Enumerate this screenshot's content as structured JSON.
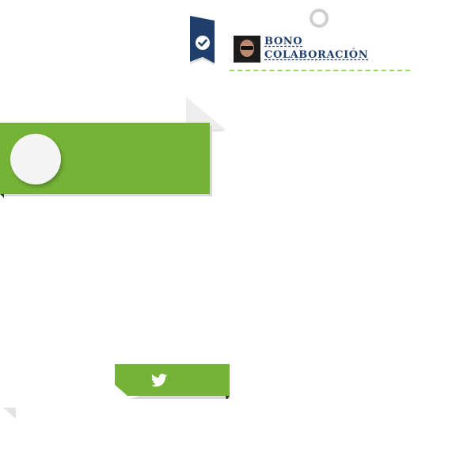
{
  "theme": {
    "accent_green": "#74b336",
    "navy": "#1f3f6a",
    "dash_green": "#9fd36d"
  },
  "header": {
    "ring_icon": "ring-icon",
    "bookmark_icon": "check-bookmark-icon"
  },
  "user_card": {
    "title_line1": "BONO",
    "title_line2": "COLABORACIÓN"
  },
  "banner": {
    "circle_icon": "blank-circle"
  },
  "share": {
    "twitter_icon": "twitter-icon"
  }
}
